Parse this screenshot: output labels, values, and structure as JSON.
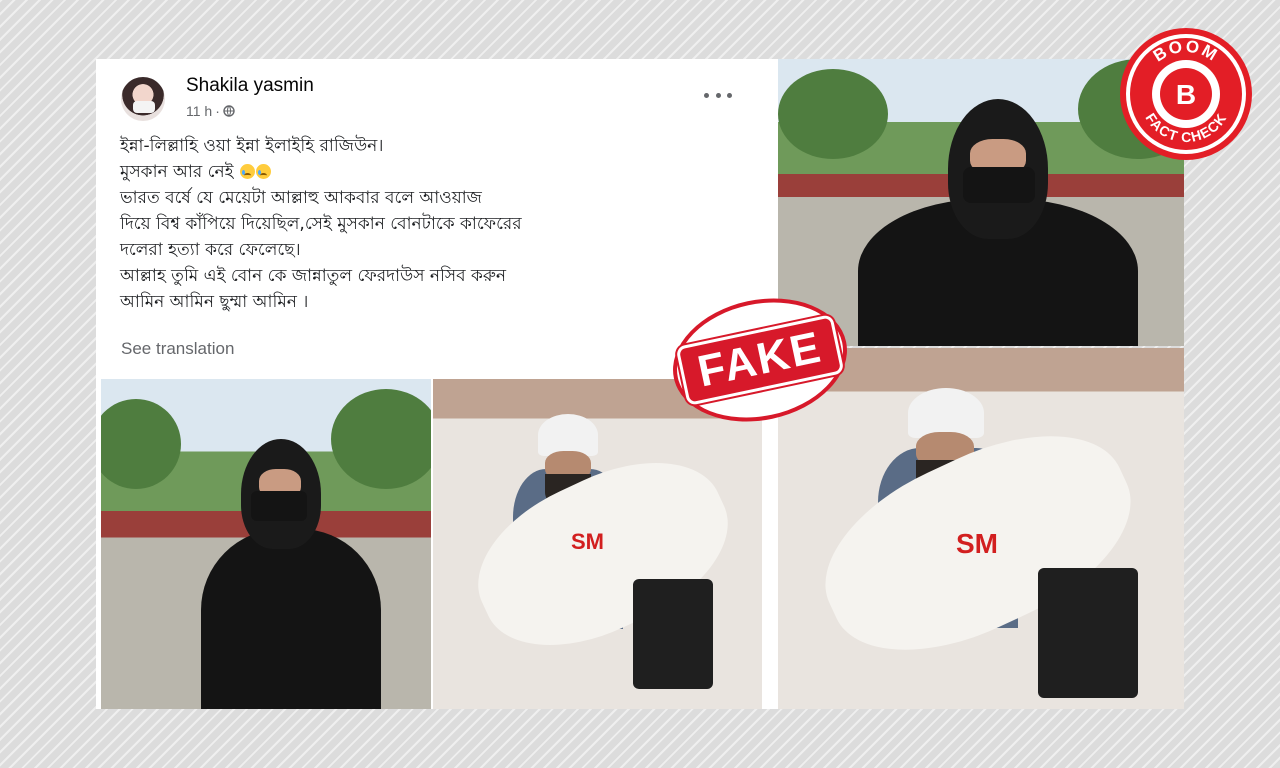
{
  "post": {
    "author": "Shakila yasmin",
    "time": "11 h",
    "separator": "·",
    "icons": {
      "privacy": "globe-icon",
      "menu": "more-options-icon"
    },
    "lines": [
      "ইন্না-লিল্লাহি ওয়া ইন্না ইলাইহি রাজিউন।",
      "মুসকান আর নেই",
      "ভারত বর্ষে যে মেয়েটা আল্লাহু আকবার বলে আওয়াজ",
      "দিয়ে বিশ্ব কাঁপিয়ে দিয়েছিল,সেই মুসকান বোনটাকে কাফেরের",
      "দলেরা হত্যা করে ফেলেছে।",
      "আল্লাহ তুমি এই বোন কে জান্নাতুল ফেরদাউস নসিব করুন",
      "আমিন আমিন ছুম্মা আমিন ।"
    ],
    "emoji": "crying-face-emoji",
    "see_translation": "See translation"
  },
  "photos": {
    "image_watermark": "SM"
  },
  "stamp": {
    "label": "FAKE",
    "color": "#d7192a"
  },
  "logo": {
    "top": "BOOM",
    "letter": "B",
    "bottom": "FACT CHECK",
    "color": "#e31e26"
  },
  "colors": {
    "background": "#dcdcdc",
    "card": "#ffffff",
    "secondary_text": "#65676b"
  }
}
